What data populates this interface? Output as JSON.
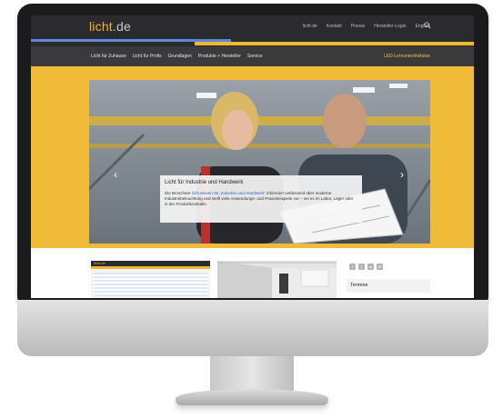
{
  "site": {
    "logo_main": "licht",
    "logo_suffix": ".de"
  },
  "utility_nav": [
    {
      "label": "licht.de"
    },
    {
      "label": "Kontakt"
    },
    {
      "label": "Presse"
    },
    {
      "label": "Hersteller-Login"
    },
    {
      "label": "English"
    }
  ],
  "utility_search_icon": "search-icon",
  "main_nav": [
    {
      "label": "Licht für Zuhause"
    },
    {
      "label": "Licht für Profis"
    },
    {
      "label": "Grundlagen"
    },
    {
      "label": "Produkte + Hersteller"
    },
    {
      "label": "Service"
    }
  ],
  "main_nav_cta": "LED-Lehrunterlinkfakte",
  "hero": {
    "caption_title": "Licht für Industrie und Handwerk",
    "caption_text_pre": "Die Broschüre ",
    "caption_link": "licht.wissen 05 „Industrie und Handwerk“",
    "caption_text_post": " informiert umfassend über moderne Industriebeleuchtung und stellt viele Anwendungs- und Praxisbeispiele vor – sei es im Labor, Lager oder in der Produktionshalle.",
    "prev_arrow": "‹",
    "next_arrow": "›"
  },
  "bottom": {
    "card1_logo": "licht.de",
    "social_icons": [
      "facebook-icon",
      "twitter-icon",
      "user-icon",
      "mail-icon"
    ],
    "termine_label": "Termine"
  },
  "colors": {
    "accent_gold": "#f2b730",
    "accent_blue": "#5b8ad6",
    "header_dark": "#2b2b2e",
    "link_blue": "#2f63c8"
  }
}
